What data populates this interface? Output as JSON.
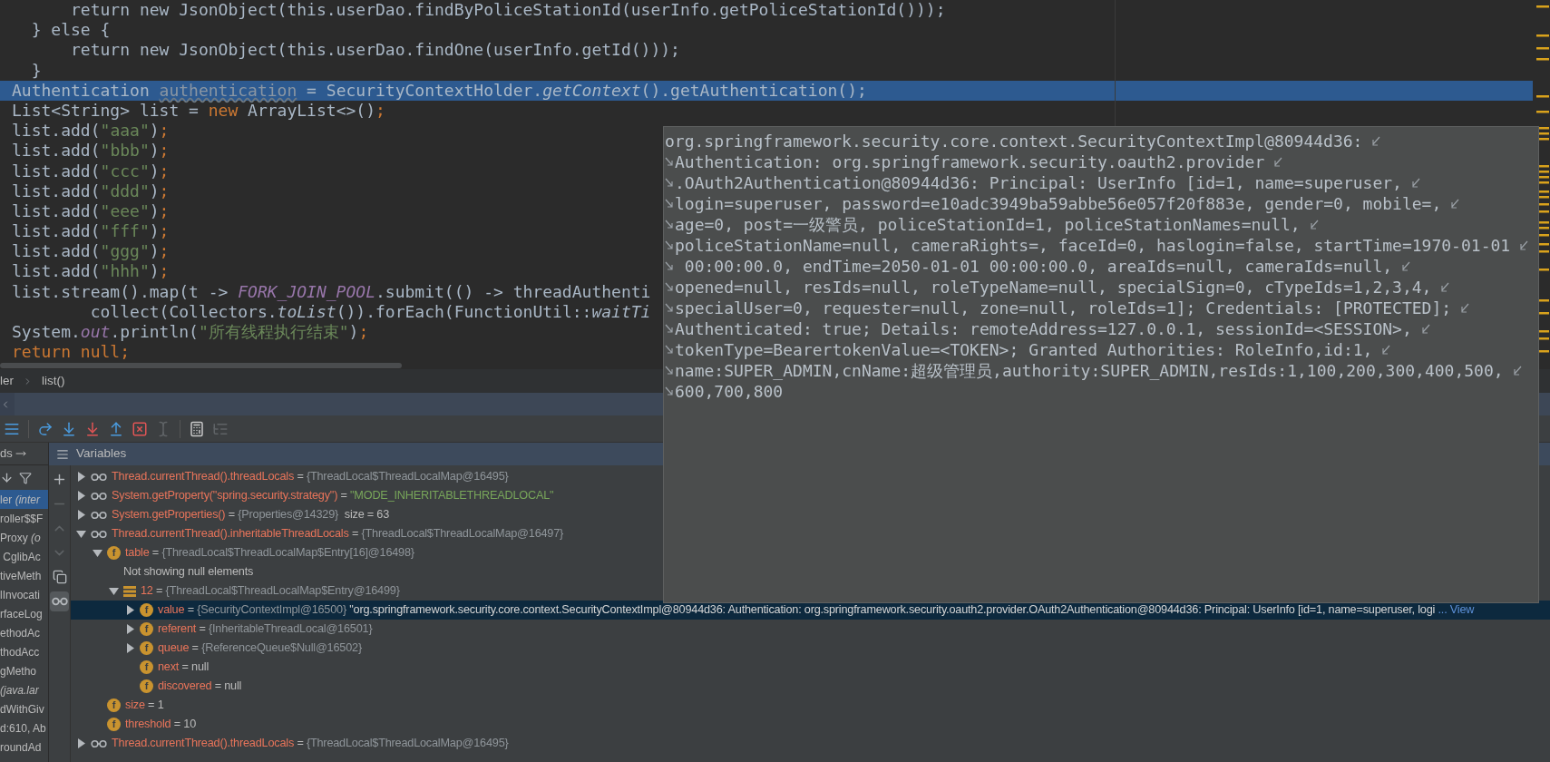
{
  "editor": {
    "lines": [
      {
        "selected": false,
        "segments": [
          {
            "kind": "plain",
            "text": "      return new JsonObject(this.userDao.findByPoliceStationId(userInfo.getPoliceStationId()));"
          }
        ]
      },
      {
        "selected": false,
        "segments": [
          {
            "kind": "plain",
            "text": "  } else {"
          }
        ]
      },
      {
        "selected": false,
        "segments": [
          {
            "kind": "plain",
            "text": "      return new JsonObject(this.userDao.findOne(userInfo.getId()));"
          }
        ]
      },
      {
        "selected": false,
        "segments": [
          {
            "kind": "plain",
            "text": "  }"
          }
        ]
      },
      {
        "selected": true,
        "segments": [
          {
            "kind": "plain",
            "text": "Authentication "
          },
          {
            "kind": "unused",
            "text": "authentication"
          },
          {
            "kind": "plain",
            "text": " = SecurityContextHolder."
          },
          {
            "kind": "italic",
            "text": "getContext"
          },
          {
            "kind": "plain",
            "text": "().getAuthentication();"
          }
        ]
      },
      {
        "selected": false,
        "segments": [
          {
            "kind": "plain",
            "text": "List<String> list = "
          },
          {
            "kind": "keyword",
            "text": "new"
          },
          {
            "kind": "plain",
            "text": " ArrayList<>()"
          },
          {
            "kind": "keyword",
            "text": ";"
          }
        ]
      },
      {
        "selected": false,
        "segments": [
          {
            "kind": "plain",
            "text": "list.add("
          },
          {
            "kind": "string",
            "text": "\"aaa\""
          },
          {
            "kind": "plain",
            "text": ")"
          },
          {
            "kind": "keyword",
            "text": ";"
          }
        ]
      },
      {
        "selected": false,
        "segments": [
          {
            "kind": "plain",
            "text": "list.add("
          },
          {
            "kind": "string",
            "text": "\"bbb\""
          },
          {
            "kind": "plain",
            "text": ")"
          },
          {
            "kind": "keyword",
            "text": ";"
          }
        ]
      },
      {
        "selected": false,
        "segments": [
          {
            "kind": "plain",
            "text": "list.add("
          },
          {
            "kind": "string",
            "text": "\"ccc\""
          },
          {
            "kind": "plain",
            "text": ")"
          },
          {
            "kind": "keyword",
            "text": ";"
          }
        ]
      },
      {
        "selected": false,
        "segments": [
          {
            "kind": "plain",
            "text": "list.add("
          },
          {
            "kind": "string",
            "text": "\"ddd\""
          },
          {
            "kind": "plain",
            "text": ")"
          },
          {
            "kind": "keyword",
            "text": ";"
          }
        ]
      },
      {
        "selected": false,
        "segments": [
          {
            "kind": "plain",
            "text": "list.add("
          },
          {
            "kind": "string",
            "text": "\"eee\""
          },
          {
            "kind": "plain",
            "text": ")"
          },
          {
            "kind": "keyword",
            "text": ";"
          }
        ]
      },
      {
        "selected": false,
        "segments": [
          {
            "kind": "plain",
            "text": "list.add("
          },
          {
            "kind": "string",
            "text": "\"fff\""
          },
          {
            "kind": "plain",
            "text": ")"
          },
          {
            "kind": "keyword",
            "text": ";"
          }
        ]
      },
      {
        "selected": false,
        "segments": [
          {
            "kind": "plain",
            "text": "list.add("
          },
          {
            "kind": "string",
            "text": "\"ggg\""
          },
          {
            "kind": "plain",
            "text": ")"
          },
          {
            "kind": "keyword",
            "text": ";"
          }
        ]
      },
      {
        "selected": false,
        "segments": [
          {
            "kind": "plain",
            "text": "list.add("
          },
          {
            "kind": "string",
            "text": "\"hhh\""
          },
          {
            "kind": "plain",
            "text": ")"
          },
          {
            "kind": "keyword",
            "text": ";"
          }
        ]
      },
      {
        "selected": false,
        "segments": [
          {
            "kind": "plain",
            "text": "list.stream().map(t -> "
          },
          {
            "kind": "constant",
            "text": "FORK_JOIN_POOL"
          },
          {
            "kind": "plain",
            "text": ".submit(() -> threadAuthenti"
          }
        ]
      },
      {
        "selected": false,
        "segments": [
          {
            "kind": "plain",
            "text": "        collect(Collectors."
          },
          {
            "kind": "italic",
            "text": "toList"
          },
          {
            "kind": "plain",
            "text": "()).forEach(FunctionUtil::"
          },
          {
            "kind": "italic",
            "text": "waitTi"
          }
        ]
      },
      {
        "selected": false,
        "segments": [
          {
            "kind": "plain",
            "text": "System."
          },
          {
            "kind": "constant",
            "text": "out"
          },
          {
            "kind": "plain",
            "text": ".println("
          },
          {
            "kind": "string",
            "text": "\"所有线程执行结束\""
          },
          {
            "kind": "plain",
            "text": ")"
          },
          {
            "kind": "keyword",
            "text": ";"
          }
        ]
      },
      {
        "selected": false,
        "segments": [
          {
            "kind": "keyword",
            "text": "return null;"
          }
        ]
      }
    ]
  },
  "tooltip": {
    "lines": [
      "org.springframework.security.core.context.SecurityContextImpl@80944d36:",
      "Authentication: org.springframework.security.oauth2.provider",
      ".OAuth2Authentication@80944d36: Principal: UserInfo [id=1, name=superuser,",
      "login=superuser, password=e10adc3949ba59abbe56e057f20f883e, gender=0, mobile=,",
      "age=0, post=一级警员, policeStationId=1, policeStationNames=null,",
      "policeStationName=null, cameraRights=, faceId=0, haslogin=false, startTime=1970-01-01",
      " 00:00:00.0, endTime=2050-01-01 00:00:00.0, areaIds=null, cameraIds=null,",
      "opened=null, resIds=null, roleTypeName=null, specialSign=0, cTypeIds=1,2,3,4,",
      "specialUser=0, requester=null, zone=null, roleIds=1]; Credentials: [PROTECTED];",
      "Authenticated: true; Details: remoteAddress=127.0.0.1, sessionId=<SESSION>,",
      "tokenType=BearertokenValue=<TOKEN>; Granted Authorities: RoleInfo,id:1,",
      "name:SUPER_ADMIN,cnName:超级管理员,authority:SUPER_ADMIN,resIds:1,100,200,300,400,500,",
      "600,700,800"
    ]
  },
  "breadcrumbs": [
    "ler",
    "list()"
  ],
  "toolbar": [
    {
      "kind": "layout",
      "disabled": false
    },
    {
      "kind": "step_over",
      "disabled": false
    },
    {
      "kind": "step_into",
      "disabled": false
    },
    {
      "kind": "force_step_into",
      "disabled": false
    },
    {
      "kind": "step_out",
      "disabled": false
    },
    {
      "kind": "drop_frame",
      "disabled": false
    },
    {
      "kind": "run_to_cursor",
      "disabled": true
    },
    {
      "kind": "evaluate",
      "disabled": false
    },
    {
      "kind": "trace",
      "disabled": true
    }
  ],
  "frames": {
    "title": "ds",
    "items": [
      {
        "text": "ler *(inter*",
        "selected": true
      },
      {
        "text": "roller$$F",
        "selected": false
      },
      {
        "text": "Proxy *(o*",
        "selected": false
      },
      {
        "text": " CglibAc",
        "selected": false
      },
      {
        "text": "tiveMeth",
        "selected": false
      },
      {
        "text": "lInvocati",
        "selected": false
      },
      {
        "text": "rfaceLog",
        "selected": false
      },
      {
        "text": "ethodAc",
        "selected": false
      },
      {
        "text": "thodAcc",
        "selected": false
      },
      {
        "text": "gMetho",
        "selected": false
      },
      {
        "text": "*(java.lar*",
        "selected": false
      },
      {
        "text": "dWithGiv",
        "selected": false
      },
      {
        "text": "d:610, Ab",
        "selected": false
      },
      {
        "text": "roundAd",
        "selected": false
      }
    ]
  },
  "side_toolbar": [
    {
      "kind": "add",
      "disabled": false,
      "selected": false
    },
    {
      "kind": "remove",
      "disabled": true,
      "selected": false
    },
    {
      "kind": "up",
      "disabled": true,
      "selected": false
    },
    {
      "kind": "down",
      "disabled": true,
      "selected": false
    },
    {
      "kind": "copy",
      "disabled": false,
      "selected": false
    },
    {
      "kind": "watches",
      "disabled": false,
      "selected": true
    }
  ],
  "variables": {
    "title": "Variables",
    "rows": [
      {
        "kind": "watch",
        "name": "Thread.currentThread().threadLocals",
        "sep": "=",
        "ref": "{ThreadLocal$ThreadLocalMap@16495}",
        "expanded": false,
        "selected": false
      },
      {
        "kind": "watch",
        "name": "System.getProperty(\"spring.security.strategy\")",
        "sep": "=",
        "string": "\"MODE_INHERITABLETHREADLOCAL\"",
        "expanded": false,
        "selected": false
      },
      {
        "kind": "watch",
        "name": "System.getProperties()",
        "sep": "=",
        "ref": "{Properties@14329}",
        "extra": "size = 63",
        "expanded": false,
        "selected": false
      },
      {
        "kind": "watch",
        "name": "Thread.currentThread().inheritableThreadLocals",
        "sep": "=",
        "ref": "{ThreadLocal$ThreadLocalMap@16497}",
        "expanded": true,
        "selected": false,
        "children": [
          {
            "kind": "field",
            "badge": "f",
            "name": "table",
            "sep": "=",
            "ref": "{ThreadLocal$ThreadLocalMap$Entry[16]@16498}",
            "expanded": true,
            "selected": false,
            "children": [
              {
                "kind": "message",
                "text": "Not showing null elements",
                "selected": false
              },
              {
                "kind": "element",
                "name": "12",
                "sep": "=",
                "ref": "{ThreadLocal$ThreadLocalMap$Entry@16499}",
                "expanded": true,
                "selected": false,
                "children": [
                  {
                    "kind": "field",
                    "badge": "f",
                    "name": "value",
                    "sep": "=",
                    "ref": "{SecurityContextImpl@16500}",
                    "string": "\"org.springframework.security.core.context.SecurityContextImpl@80944d36: Authentication: org.springframework.security.oauth2.provider.OAuth2Authentication@80944d36: Principal: UserInfo [id=1, name=superuser, logi",
                    "link": "... View",
                    "expanded": false,
                    "selected": true
                  },
                  {
                    "kind": "field",
                    "badge": "f",
                    "name": "referent",
                    "sep": "=",
                    "ref": "{InheritableThreadLocal@16501}",
                    "expanded": false,
                    "selected": false
                  },
                  {
                    "kind": "field",
                    "badge": "f",
                    "name": "queue",
                    "sep": "=",
                    "ref": "{ReferenceQueue$Null@16502}",
                    "expanded": false,
                    "selected": false
                  },
                  {
                    "kind": "field",
                    "badge": "f",
                    "name": "next",
                    "sep": "=",
                    "plain": "null",
                    "selected": false
                  },
                  {
                    "kind": "field",
                    "badge": "f",
                    "name": "discovered",
                    "sep": "=",
                    "plain": "null",
                    "selected": false
                  }
                ]
              }
            ]
          },
          {
            "kind": "field",
            "badge": "f",
            "name": "size",
            "sep": "=",
            "plain": "1",
            "selected": false
          },
          {
            "kind": "field",
            "badge": "f",
            "name": "threshold",
            "sep": "=",
            "plain": "10",
            "selected": false
          }
        ]
      },
      {
        "kind": "watch",
        "name": "Thread.currentThread().threadLocals",
        "sep": "=",
        "ref": "{ThreadLocal$ThreadLocalMap@16495}",
        "expanded": false,
        "selected": false
      }
    ]
  }
}
